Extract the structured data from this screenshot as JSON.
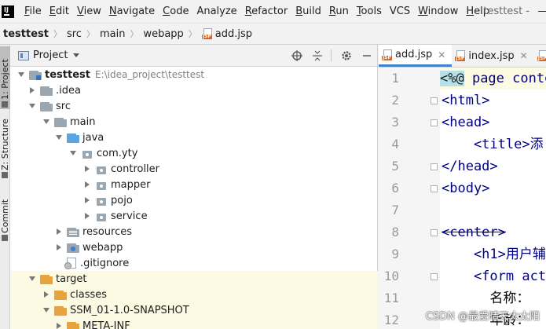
{
  "menubar": {
    "items": [
      {
        "label": "File",
        "u": "F",
        "rest": "ile"
      },
      {
        "label": "Edit",
        "u": "E",
        "rest": "dit"
      },
      {
        "label": "View",
        "u": "V",
        "rest": "iew"
      },
      {
        "label": "Navigate",
        "u": "N",
        "rest": "avigate"
      },
      {
        "label": "Code",
        "u": "C",
        "rest": "ode"
      },
      {
        "label": "Analyze",
        "u": "",
        "rest": "Analyze"
      },
      {
        "label": "Refactor",
        "u": "R",
        "rest": "efactor"
      },
      {
        "label": "Build",
        "u": "B",
        "rest": "uild"
      },
      {
        "label": "Run",
        "u": "R",
        "rest": "un"
      },
      {
        "label": "Tools",
        "u": "T",
        "rest": "ools"
      },
      {
        "label": "VCS",
        "u": "",
        "rest": "VCS"
      },
      {
        "label": "Window",
        "u": "W",
        "rest": "indow"
      },
      {
        "label": "Help",
        "u": "H",
        "rest": "elp"
      }
    ],
    "window_title": "testtest -"
  },
  "breadcrumb": {
    "items": [
      "testtest",
      "src",
      "main",
      "webapp",
      "add.jsp"
    ]
  },
  "toolstrip": {
    "tabs": [
      "1: Project",
      "Z: Structure",
      "Commit"
    ]
  },
  "project_panel": {
    "title": "Project",
    "tree": [
      {
        "label": "testtest",
        "path": "E:\\idea_project\\testtest"
      },
      {
        "label": ".idea"
      },
      {
        "label": "src"
      },
      {
        "label": "main"
      },
      {
        "label": "java"
      },
      {
        "label": "com.yty"
      },
      {
        "label": "controller"
      },
      {
        "label": "mapper"
      },
      {
        "label": "pojo"
      },
      {
        "label": "service"
      },
      {
        "label": "resources"
      },
      {
        "label": "webapp"
      },
      {
        "label": ".gitignore"
      },
      {
        "label": "target"
      },
      {
        "label": "classes"
      },
      {
        "label": "SSM_01-1.0-SNAPSHOT"
      },
      {
        "label": "META-INF"
      }
    ]
  },
  "editor": {
    "tabs": [
      {
        "label": "add.jsp",
        "active": true
      },
      {
        "label": "index.jsp",
        "active": false
      }
    ],
    "line_numbers": [
      "1",
      "2",
      "3",
      "4",
      "5",
      "6",
      "7",
      "8",
      "9",
      "10",
      "11",
      "12"
    ],
    "lines": {
      "l1_open": "<%@",
      "l1_rest": " page conte",
      "l2": "<html>",
      "l3": "<head>",
      "l4": "    <title>添",
      "l5": "</head>",
      "l6": "<body>",
      "l8": "<center>",
      "l9": "    <h1>用户辅",
      "l10": "    <form act",
      "l11": "      名称：",
      "l12": "      年龄："
    }
  },
  "watermark": "CSDN @最爱晴天大太阳",
  "colors": {
    "accent": "#4083c9",
    "folder_orange": "#e6a33e",
    "folder_blue": "#5da3e0",
    "folder_gray": "#9aa7b0",
    "current_line": "#fcfae2",
    "tag_navy": "#000080"
  }
}
